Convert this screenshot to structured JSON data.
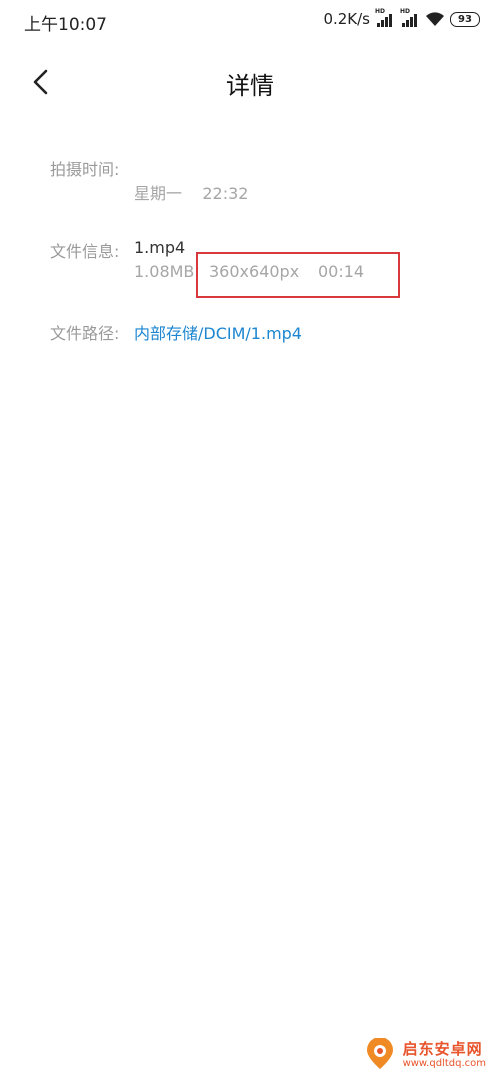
{
  "status_bar": {
    "time": "上午10:07",
    "net_speed": "0.2K/s",
    "signal_1_badge": "HD",
    "signal_2_badge": "HD",
    "battery": "93"
  },
  "header": {
    "title": "详情"
  },
  "details": {
    "capture_time_label": "拍摄时间:",
    "capture_time_value": "星期一    22:32",
    "file_info_label": "文件信息:",
    "file_name": "1.mp4",
    "file_size": "1.08MB",
    "resolution": "360x640px",
    "duration": "00:14",
    "file_path_label": "文件路径:",
    "file_path": "内部存储/DCIM/1.mp4"
  },
  "watermark": {
    "name": "启东安卓网",
    "url": "www.qdltdq.com"
  },
  "colors": {
    "link": "#1c86d1",
    "highlight": "#d9393d",
    "watermark": "#e8542b"
  }
}
